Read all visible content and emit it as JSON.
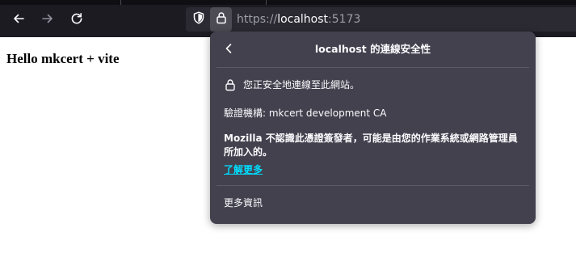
{
  "browser": {
    "url": {
      "scheme": "https://",
      "host": "localhost",
      "port": ":5173"
    },
    "icons": {
      "back": "arrow-left-icon",
      "forward": "arrow-right-icon",
      "reload": "reload-icon",
      "tracking_protection": "shield-icon",
      "site_security": "lock-icon"
    },
    "colors": {
      "toolbar": "#1c1b22",
      "urlbar": "#2b2a33",
      "panel": "#42414d",
      "link": "#00ddff"
    }
  },
  "page": {
    "heading": "Hello mkcert + vite"
  },
  "security_panel": {
    "title": "localhost 的連線安全性",
    "secure_connection": "您正安全地連線至此網站。",
    "verified_by": "驗證機構: mkcert development CA",
    "warning": "Mozilla 不認識此憑證簽發者，可能是由您的作業系統或網路管理員所加入的。",
    "learn_more": "了解更多",
    "more_info": "更多資訊"
  }
}
